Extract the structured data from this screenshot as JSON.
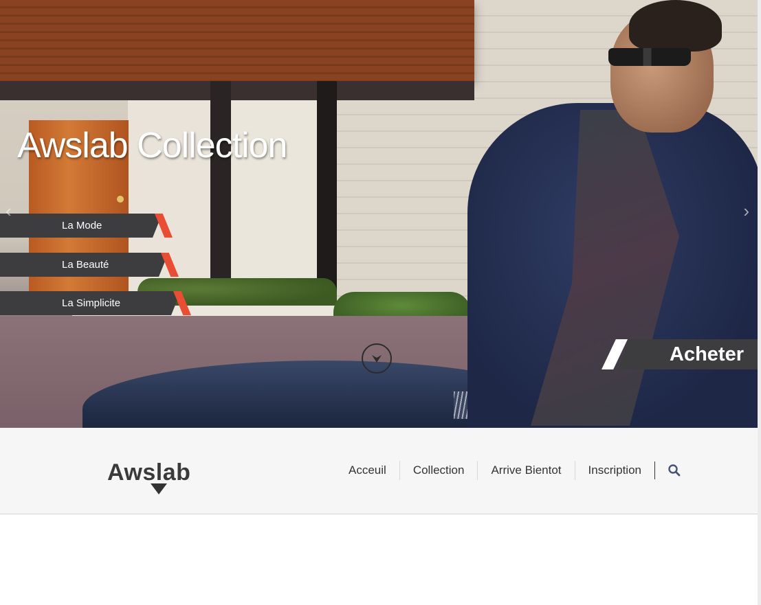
{
  "hero": {
    "title": "Awslab Collection",
    "tags": [
      "La Mode",
      "La Beauté",
      "La Simplicite"
    ],
    "buy_label": "Acheter",
    "prev_arrow": "‹",
    "next_arrow": "›",
    "icons": {
      "scroll": "chevron-down-circle-icon"
    }
  },
  "header": {
    "logo": "Awslab",
    "menu": [
      "Acceuil",
      "Collection",
      "Arrive Bientot",
      "Inscription"
    ],
    "icons": {
      "search": "search-icon"
    }
  },
  "colors": {
    "accent": "#e94e34",
    "dark_label": "#3d3d3f",
    "navbar_bg": "#f6f6f6"
  }
}
